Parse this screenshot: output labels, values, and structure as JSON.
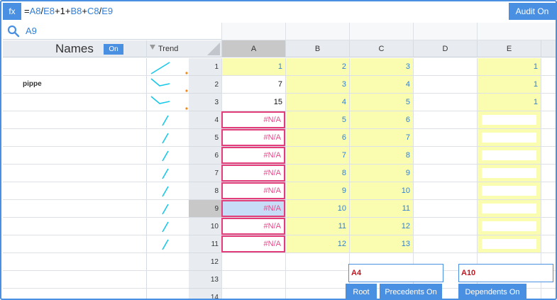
{
  "formula_bar": {
    "fx_label": "fx",
    "parts": [
      {
        "t": "=",
        "ref": false
      },
      {
        "t": "A8",
        "ref": true
      },
      {
        "t": "/",
        "ref": false
      },
      {
        "t": "E8",
        "ref": true
      },
      {
        "t": "+1+",
        "ref": false
      },
      {
        "t": "B8",
        "ref": true
      },
      {
        "t": "+",
        "ref": false
      },
      {
        "t": "C8",
        "ref": true
      },
      {
        "t": "/",
        "ref": false
      },
      {
        "t": "E9",
        "ref": true
      }
    ],
    "audit_label": "Audit On"
  },
  "search": {
    "value": "A9",
    "icon": "search-icon"
  },
  "names_panel": {
    "title": "Names",
    "toggle_label": "On",
    "trend_label": "Trend"
  },
  "columns": [
    "A",
    "B",
    "C",
    "D",
    "E"
  ],
  "selected_column": "A",
  "rows": [
    {
      "num": "1",
      "name": "",
      "trend": "up-dots",
      "A": "1",
      "B": "2",
      "C": "3",
      "D": "",
      "E": "1"
    },
    {
      "num": "2",
      "name": "pippe",
      "trend": "vdown-dots",
      "A": "7",
      "B": "3",
      "C": "4",
      "D": "",
      "E": "1"
    },
    {
      "num": "3",
      "name": "",
      "trend": "vdown-dots",
      "A": "15",
      "B": "4",
      "C": "5",
      "D": "",
      "E": "1"
    },
    {
      "num": "4",
      "name": "",
      "trend": "slash",
      "A": "#N/A",
      "B": "5",
      "C": "6",
      "D": "",
      "E": ""
    },
    {
      "num": "5",
      "name": "",
      "trend": "slash",
      "A": "#N/A",
      "B": "6",
      "C": "7",
      "D": "",
      "E": ""
    },
    {
      "num": "6",
      "name": "",
      "trend": "slash",
      "A": "#N/A",
      "B": "7",
      "C": "8",
      "D": "",
      "E": ""
    },
    {
      "num": "7",
      "name": "",
      "trend": "slash",
      "A": "#N/A",
      "B": "8",
      "C": "9",
      "D": "",
      "E": ""
    },
    {
      "num": "8",
      "name": "",
      "trend": "slash",
      "A": "#N/A",
      "B": "9",
      "C": "10",
      "D": "",
      "E": ""
    },
    {
      "num": "9",
      "name": "",
      "trend": "slash",
      "A": "#N/A",
      "B": "10",
      "C": "11",
      "D": "",
      "E": ""
    },
    {
      "num": "10",
      "name": "",
      "trend": "slash",
      "A": "#N/A",
      "B": "11",
      "C": "12",
      "D": "",
      "E": ""
    },
    {
      "num": "11",
      "name": "",
      "trend": "slash",
      "A": "#N/A",
      "B": "12",
      "C": "13",
      "D": "",
      "E": ""
    },
    {
      "num": "12",
      "name": "",
      "trend": "",
      "A": "",
      "B": "",
      "C": "",
      "D": "",
      "E": ""
    },
    {
      "num": "13",
      "name": "",
      "trend": "",
      "A": "",
      "B": "",
      "C": "",
      "D": "",
      "E": ""
    },
    {
      "num": "14",
      "name": "",
      "trend": "",
      "A": "",
      "B": "",
      "C": "",
      "D": "",
      "E": ""
    }
  ],
  "selected_row": "9",
  "audit": {
    "precedent_cell": "A4",
    "dependent_cell": "A10",
    "root_label": "Root",
    "precedents_label": "Precedents On",
    "dependents_label": "Dependents On"
  },
  "colors": {
    "accent": "#4a90e2",
    "yellow": "#fafcb0",
    "error": "#e23c7a",
    "ref_text": "#2f7fd8",
    "trend_line": "#18c8e8",
    "trend_dot": "#f08a1c"
  }
}
